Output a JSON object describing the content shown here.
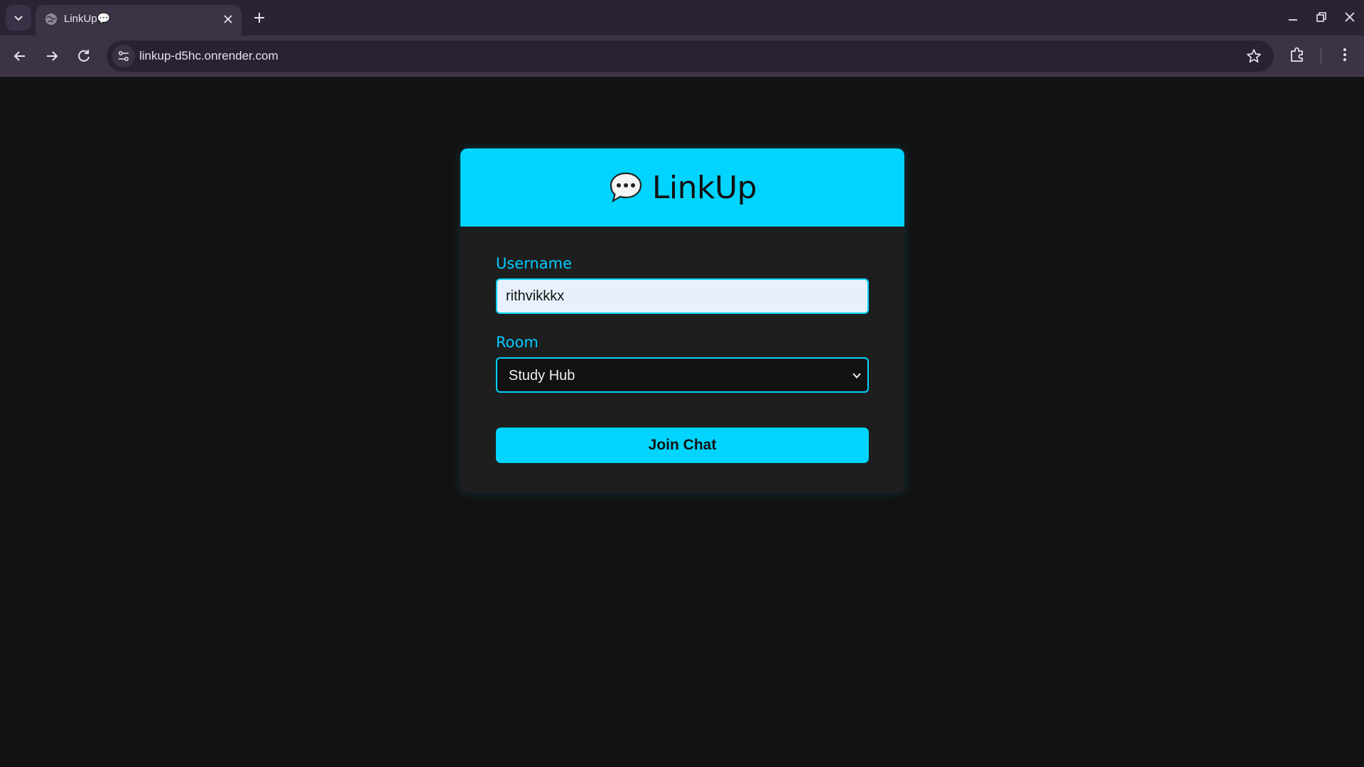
{
  "browser": {
    "tab": {
      "title": "LinkUp💬"
    },
    "address_bar": {
      "url": "linkup-d5hc.onrender.com"
    }
  },
  "icons": {
    "tab_list": "chevron-down-icon",
    "favicon": "globe-icon",
    "tab_close": "close-icon",
    "new_tab": "plus-icon",
    "minimize": "minimize-icon",
    "restore": "restore-icon",
    "close_window": "close-icon",
    "back": "arrow-left-icon",
    "forward": "arrow-right-icon",
    "reload": "reload-icon",
    "site_info": "tune-icon",
    "bookmark": "star-icon",
    "extensions": "puzzle-icon",
    "menu": "kebab-menu-icon",
    "brand": "speech-bubble-icon",
    "select_arrow": "chevron-down-icon"
  },
  "colors": {
    "accent": "#00d4ff",
    "page_background": "#121212",
    "card_background": "#1e1e1e",
    "label": "#00ccff",
    "browser_frame": "#2b2234",
    "browser_toolbar": "#3c3446"
  },
  "app": {
    "brand_name": "LinkUp",
    "form": {
      "username_label": "Username",
      "username_value": "rithvikkkx",
      "room_label": "Room",
      "room_selected": "Study Hub",
      "submit_label": "Join Chat"
    }
  }
}
